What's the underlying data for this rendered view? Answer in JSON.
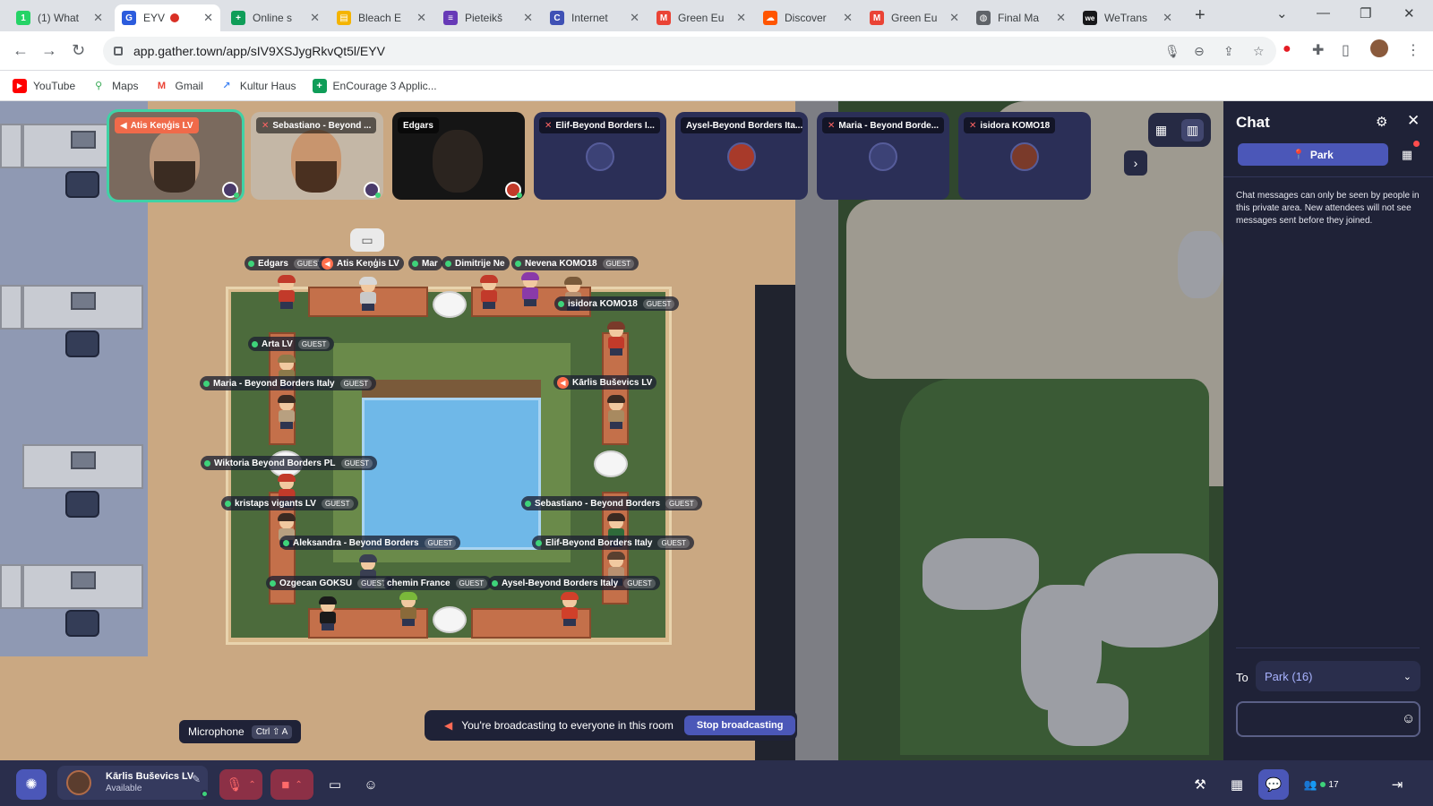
{
  "browser": {
    "tabs": [
      {
        "title": "(1) What",
        "fav": "whatsapp-icon",
        "color": "#25d366",
        "glyph": "1"
      },
      {
        "title": "EYV",
        "fav": "gather-icon",
        "color": "#2c5cdd",
        "glyph": "G",
        "active": true,
        "recording": true
      },
      {
        "title": "Online s",
        "fav": "sheets-icon",
        "color": "#0f9d58",
        "glyph": "+"
      },
      {
        "title": "Bleach E",
        "fav": "slides-icon",
        "color": "#f4b400",
        "glyph": "▤"
      },
      {
        "title": "Pieteikš",
        "fav": "forms-icon",
        "color": "#673ab7",
        "glyph": "≡"
      },
      {
        "title": "Internet",
        "fav": "web-icon",
        "color": "#3f51b5",
        "glyph": "C"
      },
      {
        "title": "Green Eu",
        "fav": "gmail-icon",
        "color": "#ea4335",
        "glyph": "M"
      },
      {
        "title": "Discover",
        "fav": "soundcloud-icon",
        "color": "#ff5500",
        "glyph": "☁"
      },
      {
        "title": "Green Eu",
        "fav": "gmail-icon",
        "color": "#ea4335",
        "glyph": "M"
      },
      {
        "title": "Final Ma",
        "fav": "globe-icon",
        "color": "#5f6368",
        "glyph": "◍"
      },
      {
        "title": "WeTrans",
        "fav": "wetransfer-icon",
        "color": "#17181a",
        "glyph": "we"
      }
    ],
    "url": "app.gather.town/app/sIV9XSJygRkvQt5l/EYV",
    "bookmarks": [
      {
        "label": "YouTube",
        "color": "#ff0000",
        "glyph": "▶"
      },
      {
        "label": "Maps",
        "color": "#34a853",
        "glyph": "⚲"
      },
      {
        "label": "Gmail",
        "color": "#ea4335",
        "glyph": "M"
      },
      {
        "label": "Kultur Haus",
        "color": "#4285f4",
        "glyph": "↗"
      },
      {
        "label": "EnCourage 3 Applic...",
        "color": "#0f9d58",
        "glyph": "+"
      }
    ]
  },
  "video": {
    "tiles": [
      {
        "name": "Atis Keņģis LV",
        "kind": "cam",
        "broadcasting": true,
        "speaking": true
      },
      {
        "name": "Sebastiano - Beyond ...",
        "kind": "cam",
        "muted": true
      },
      {
        "name": "Edgars",
        "kind": "cam-dark"
      },
      {
        "name": "Elif-Beyond Borders I...",
        "kind": "avatar",
        "muted": true
      },
      {
        "name": "Aysel-Beyond Borders Ita...",
        "kind": "avatar"
      },
      {
        "name": "Maria - Beyond Borde...",
        "kind": "avatar",
        "muted": true
      },
      {
        "name": "isidora KOMO18",
        "kind": "avatar",
        "muted": true
      }
    ]
  },
  "map": {
    "guest_label": "GUEST",
    "nametags": [
      {
        "name": "Edgars",
        "guest": true
      },
      {
        "name": "Atis Keņģis LV",
        "broadcast": true
      },
      {
        "name": "Mar",
        "guest": false
      },
      {
        "name": "Dimitrije Ne",
        "guest": false
      },
      {
        "name": "Nevena KOMO18",
        "guest": true
      },
      {
        "name": "isidora KOMO18",
        "guest": true
      },
      {
        "name": "Arta LV",
        "guest": true
      },
      {
        "name": "Maria - Beyond Borders Italy",
        "guest": true
      },
      {
        "name": "Kārlis Buševics LV",
        "broadcast": true
      },
      {
        "name": "Wiktoria Beyond Borders PL",
        "guest": true
      },
      {
        "name": "kristaps vigants LV",
        "guest": true
      },
      {
        "name": "Sebastiano - Beyond Borders",
        "guest": true
      },
      {
        "name": "Aleksandra - Beyond Borders",
        "guest": true
      },
      {
        "name": "Elif-Beyond Borders Italy",
        "guest": true
      },
      {
        "name": "Ozgecan GOKSU",
        "guest": true
      },
      {
        "name": "chemin France",
        "guest": true
      },
      {
        "name": "Aysel-Beyond Borders Italy",
        "guest": true
      }
    ]
  },
  "tooltip": {
    "label": "Microphone",
    "shortcut": "Ctrl ⇧ A"
  },
  "broadcast": {
    "message": "You're broadcasting to everyone in this room",
    "stop_label": "Stop broadcasting"
  },
  "chat": {
    "title": "Chat",
    "tab": "Park",
    "note": "Chat messages can only be seen by people in this private area. New attendees will not see messages sent before they joined.",
    "to_label": "To",
    "to_value": "Park (16)",
    "input_value": ""
  },
  "bottombar": {
    "user_name": "Kārlis Buševics LV",
    "user_status": "Available",
    "participants_count": "17"
  },
  "colors": {
    "panel": "#1f2237",
    "accent": "#4b57b8",
    "online": "#3ed37a",
    "danger": "#8c3046"
  }
}
